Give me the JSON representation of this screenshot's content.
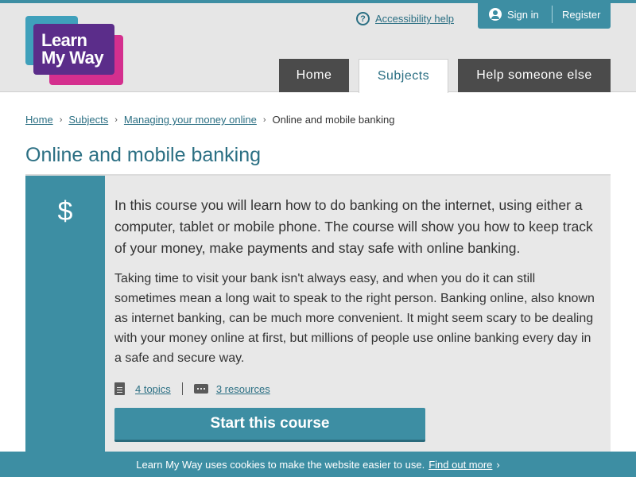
{
  "header": {
    "logo_line1": "Learn",
    "logo_line2": "My Way",
    "accessibility_icon": "?",
    "accessibility_label": "Accessibility help",
    "signin_label": "Sign in",
    "register_label": "Register"
  },
  "nav": {
    "tabs": [
      {
        "label": "Home",
        "active": false
      },
      {
        "label": "Subjects",
        "active": true
      },
      {
        "label": "Help someone else",
        "active": false
      }
    ]
  },
  "breadcrumb": {
    "items": [
      "Home",
      "Subjects",
      "Managing your money online"
    ],
    "current": "Online and mobile banking",
    "separator": "›"
  },
  "page": {
    "title": "Online and mobile banking"
  },
  "course": {
    "icon_symbol": "$",
    "lead": "In this course you will learn how to do banking on the internet, using either a computer, tablet or mobile phone. The course will show you how to keep track of your money, make payments and stay safe with online banking.",
    "description": "Taking time to visit your bank isn't always easy, and when you do it can still sometimes mean a long wait to speak to the right person. Banking online, also known as internet banking, can be much more convenient. It might seem scary to be dealing with your money online at first, but millions of people use online banking every day in a safe and secure way.",
    "topics_link": "4 topics",
    "resources_link": "3 resources",
    "start_button": "Start this course"
  },
  "cookie_banner": {
    "text": "Learn My Way uses cookies to make the website easier to use.",
    "link": "Find out more",
    "chevron": "›"
  },
  "colors": {
    "accent": "#3d8ea3",
    "link": "#2b6f83",
    "tab_dark": "#4b4b4b",
    "logo_blue": "#3fa0bb",
    "logo_purple": "#5b2d8a",
    "logo_pink": "#d42f8e"
  }
}
